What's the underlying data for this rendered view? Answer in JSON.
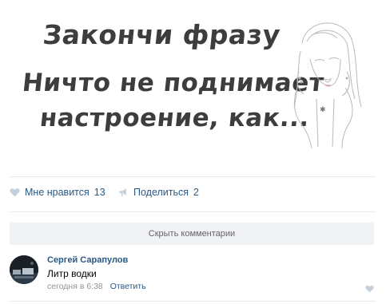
{
  "post": {
    "image_text": {
      "line1": "Закончи фразу",
      "line2": "Ничто не поднимает",
      "line3": "настроение, как..."
    },
    "likes": {
      "label": "Мне нравится",
      "count": "13",
      "icon": "heart-icon",
      "icon_color": "#c4d0db"
    },
    "share": {
      "label": "Поделиться",
      "count": "2",
      "icon": "megaphone-icon",
      "icon_color": "#c4d0db"
    }
  },
  "comments_toggle": {
    "label": "Скрыть комментарии"
  },
  "comment": {
    "author": "Сергей Сарапулов",
    "text": "Литр водки",
    "time": "сегодня в 6:38",
    "reply": "Ответить",
    "like_icon": "heart-icon"
  },
  "colors": {
    "link": "#2a5885",
    "divider": "#e7e8ec",
    "button_bg": "#f0f2f5",
    "meta": "#939393"
  }
}
